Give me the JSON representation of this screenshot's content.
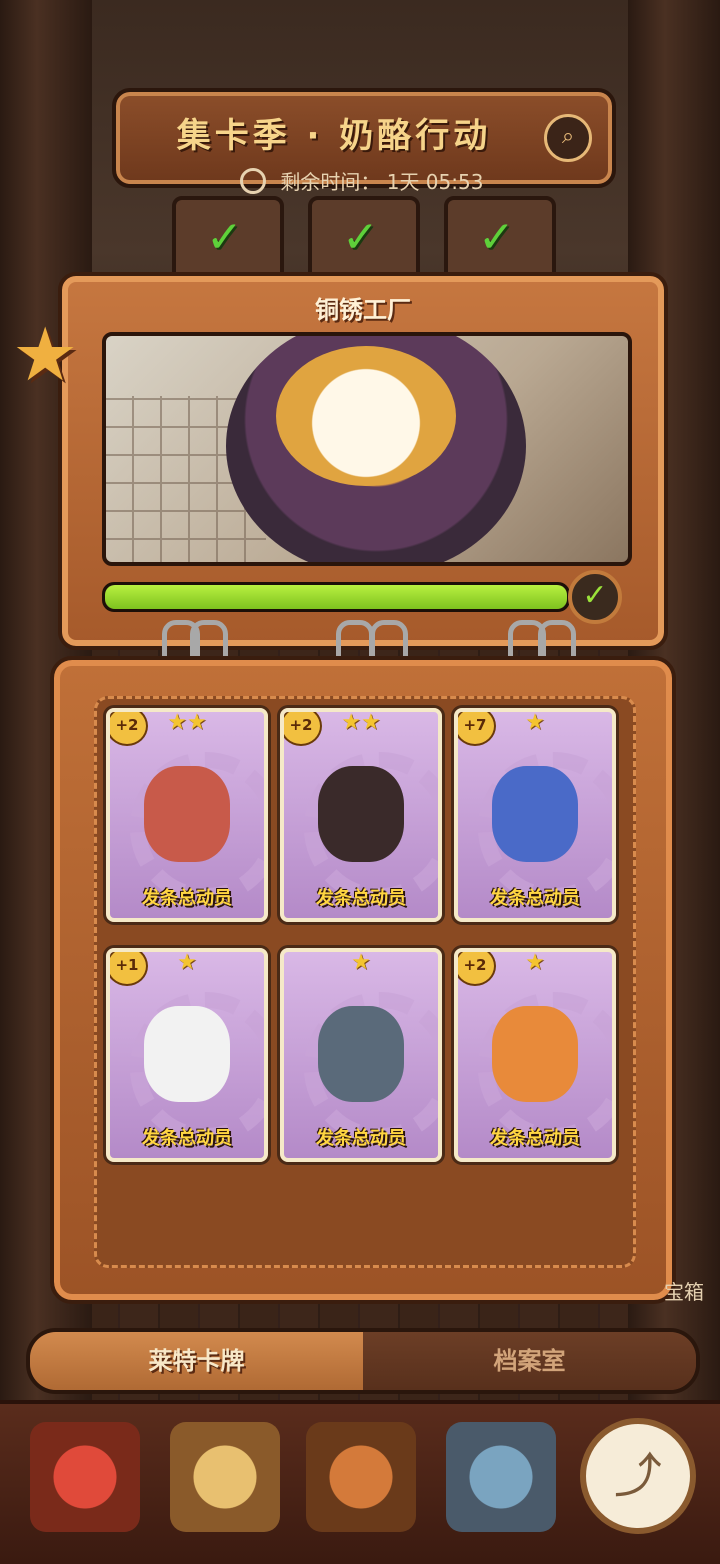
{
  "header": {
    "title": "集卡季 · 奶酪行动",
    "timer_label": "剩余时间：",
    "timer_value": "1天 05:53"
  },
  "featured_album": {
    "title": "铜锈工厂",
    "progress_percent": 100
  },
  "cards": [
    {
      "plus": "+2",
      "stars": 2,
      "name": "发条总动员"
    },
    {
      "plus": "+2",
      "stars": 2,
      "name": "发条总动员"
    },
    {
      "plus": "+7",
      "stars": 1,
      "name": "发条总动员"
    },
    {
      "plus": "+1",
      "stars": 1,
      "name": "发条总动员"
    },
    {
      "plus": "",
      "stars": 1,
      "name": "发条总动员"
    },
    {
      "plus": "+2",
      "stars": 1,
      "name": "发条总动员"
    }
  ],
  "tabs": {
    "active": "莱特卡牌",
    "inactive": "档案室"
  },
  "side_labels": {
    "right_lower": "宝箱"
  },
  "icons": {
    "search": "search-icon",
    "clock": "clock-icon",
    "check": "check-icon",
    "share": "share-icon"
  }
}
